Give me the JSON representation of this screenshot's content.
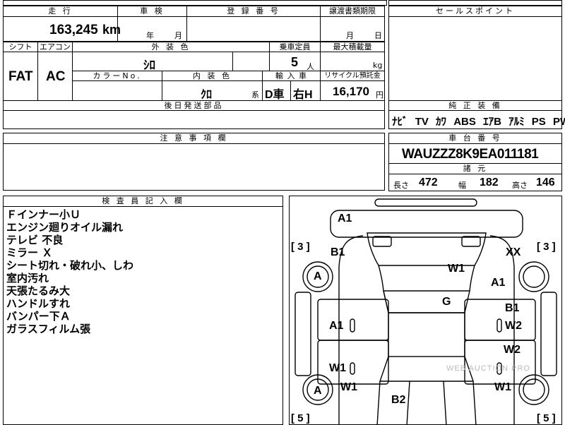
{
  "mileage": {
    "header": "走 行",
    "value": "163,245",
    "unit": "km"
  },
  "inspection": {
    "header": "車 検",
    "year": "年",
    "month": "月"
  },
  "registration": {
    "header": "登 録 番 号"
  },
  "transfer_deadline": {
    "header": "譲渡書類期限",
    "month": "月",
    "day": "日"
  },
  "sales_points": {
    "header": "セールスポイント"
  },
  "shift": {
    "header": "シフト",
    "value": "FAT"
  },
  "aircon": {
    "header": "エアコン",
    "value": "AC"
  },
  "exterior_color": {
    "header": "外 装 色",
    "value": "ｼﾛ"
  },
  "capacity": {
    "header": "乗車定員",
    "value": "5",
    "unit": "人"
  },
  "max_load": {
    "header": "最大積載量",
    "unit": "kg"
  },
  "color_no": {
    "header": "カラーNo."
  },
  "interior_color": {
    "header": "内 装 色",
    "value": "ｸﾛ",
    "suffix": "系"
  },
  "import": {
    "header": "輸 入 車",
    "dealer": "D車",
    "handle": "右H"
  },
  "recycle": {
    "header": "リサイクル預託金",
    "value": "16,170",
    "unit": "円"
  },
  "later_parts": {
    "header": "後日発送部品"
  },
  "equipment": {
    "header": "純 正 装 備",
    "items": [
      "ﾅﾋﾞ",
      "TV",
      "ｶﾜ",
      "ABS",
      "ｴｱB",
      "ｱﾙﾐ",
      "PS",
      "PW"
    ]
  },
  "caution": {
    "header": "注 意 事 項 欄"
  },
  "chassis": {
    "header": "車 台 番 号",
    "value": "WAUZZZ8K9EA011181"
  },
  "specs": {
    "header": "諸 元",
    "length_label": "長さ",
    "length": "472",
    "width_label": "幅",
    "width": "182",
    "height_label": "高さ",
    "height": "146"
  },
  "inspector": {
    "header": "検 査 員 記 入 欄",
    "notes": [
      "Ｆインナー小Ｕ",
      "エンジン廻りオイル漏れ",
      "テレビ 不良",
      "ミラー Ｘ",
      "シート切れ・破れ小、しわ",
      "室内汚れ",
      "天張たるみ大",
      "ハンドルすれ",
      "バンパー下Ａ",
      "ガラスフィルム張"
    ]
  },
  "diagram": {
    "marks": {
      "front_bumper": "A1",
      "front_left_fender": "B1",
      "front_right_fender": "XX",
      "left_front_tire": "A",
      "right_front_tire_area": "A1",
      "windshield": "W1",
      "roof": "G",
      "left_front_door": "A1",
      "right_front_door_top": "B1",
      "right_front_door": "W2",
      "right_rear_door": "W2",
      "left_rear_door": "W1",
      "left_rear_tire": "A",
      "left_rear_quarter": "W1",
      "right_rear_quarter": "W1",
      "rear_area": "B2"
    },
    "tire_tread": {
      "front_left": "3",
      "front_right": "3",
      "rear_left": "5",
      "rear_right": "5"
    },
    "watermark": "WEB AUCTION PRO"
  }
}
